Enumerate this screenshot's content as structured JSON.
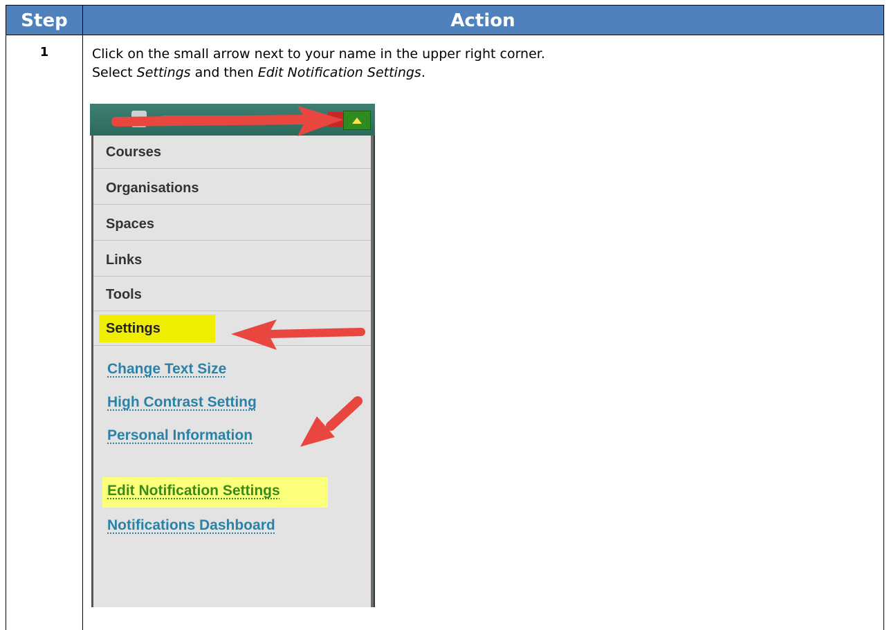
{
  "table": {
    "header": {
      "step": "Step",
      "action": "Action"
    },
    "rows": [
      {
        "step": "1",
        "line1": "Click on the small arrow next to your name in the upper right corner.",
        "line2_prefix": "Select ",
        "line2_settings": "Settings",
        "line2_mid": " and then ",
        "line2_edit": "Edit Notification Settings",
        "line2_end": "."
      }
    ]
  },
  "screenshot": {
    "menu_items": [
      "Courses",
      "Organisations",
      "Spaces",
      "Links",
      "Tools"
    ],
    "settings_label": "Settings",
    "settings_links": [
      "Change Text Size",
      "High Contrast Setting",
      "Personal Information",
      "Edit Notification Settings",
      "Notifications Dashboard"
    ],
    "highlighted_link": "Edit Notification Settings",
    "colors": {
      "header_blue": "#4f81bd",
      "highlight_yellow": "#f0ee00",
      "arrow_red": "#e8463f",
      "link_blue": "#2a82a8",
      "topbar_teal": "#2c6a5d",
      "toggle_green": "#2e8b1f"
    }
  }
}
